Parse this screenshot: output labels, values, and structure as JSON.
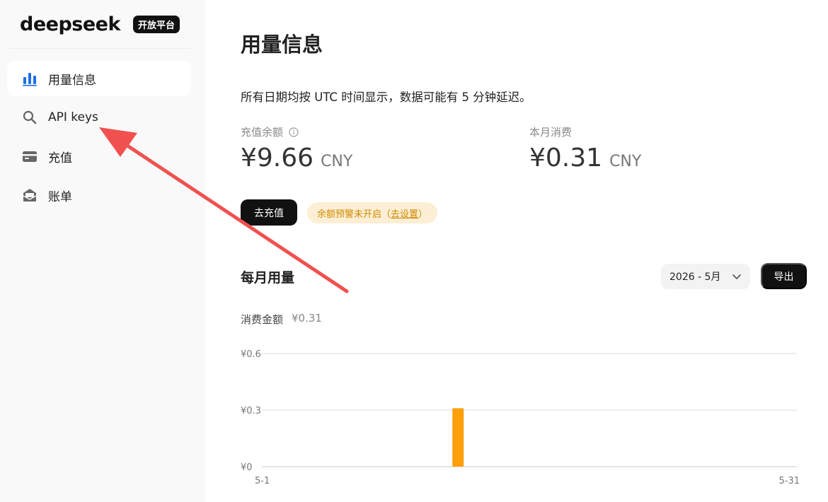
{
  "sidebar": {
    "logo": "deepseek",
    "badge": "开放平台",
    "items": [
      {
        "label": "用量信息",
        "icon": "bar-chart-icon",
        "active": true
      },
      {
        "label": "API keys",
        "icon": "search-key-icon",
        "active": false
      },
      {
        "label": "充值",
        "icon": "wallet-icon",
        "active": false
      },
      {
        "label": "账单",
        "icon": "bill-icon",
        "active": false
      }
    ]
  },
  "main": {
    "title": "用量信息",
    "notice": "所有日期均按 UTC 时间显示，数据可能有 5 分钟延迟。",
    "balance": {
      "label": "充值余额",
      "amount": "¥9.66",
      "unit": "CNY"
    },
    "monthly": {
      "label": "本月消费",
      "amount": "¥0.31",
      "unit": "CNY"
    },
    "recharge_button": "去充值",
    "alert": {
      "text": "余额预警未开启（",
      "link": "去设置",
      "suffix": "）"
    },
    "section_title": "每月用量",
    "month_select": "2026 - 5月",
    "export_button": "导出",
    "spend_label": "消费金额",
    "spend_value": "¥0.31"
  },
  "colors": {
    "accent_blue": "#1e6fe8",
    "bar": "#ff9f0a",
    "annotation_red": "#f0514f",
    "alert_bg": "#fdefd5",
    "alert_text": "#d08a00"
  },
  "chart_data": {
    "type": "bar",
    "x_start": "5-1",
    "x_end": "5-31",
    "x_tick_labels": [
      "5-1",
      "5-31"
    ],
    "y_tick_labels": [
      "¥0.6",
      "¥0.3",
      "¥0"
    ],
    "y_ticks": [
      0.6,
      0.3,
      0
    ],
    "ylim": [
      0,
      0.6
    ],
    "days": 31,
    "points": [
      {
        "day": 12,
        "value": 0.31
      }
    ],
    "grid": true
  }
}
